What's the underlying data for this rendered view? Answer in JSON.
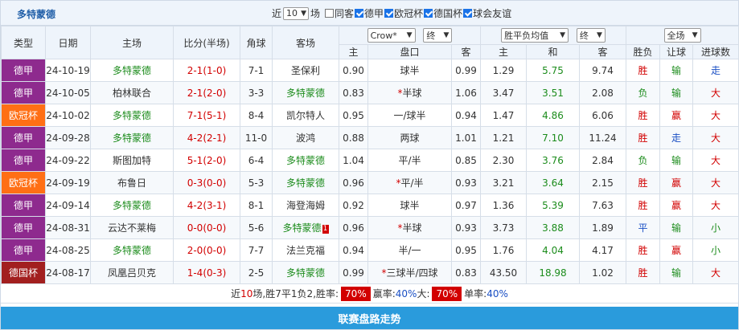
{
  "header": {
    "team_title": "多特蒙德",
    "near_label": "近",
    "near_count": "10",
    "games_label": "场",
    "filters": [
      {
        "label": "同客",
        "checked": false
      },
      {
        "label": "德甲",
        "checked": true
      },
      {
        "label": "欧冠杯",
        "checked": true
      },
      {
        "label": "德国杯",
        "checked": true
      },
      {
        "label": "球会友谊",
        "checked": true
      }
    ]
  },
  "columns": {
    "type": "类型",
    "date": "日期",
    "home": "主场",
    "score": "比分(半场)",
    "corner": "角球",
    "away": "客场",
    "bookmaker": "Crow*",
    "handicap_period": "终",
    "odds_type": "胜平负均值",
    "odds_period": "终",
    "scope": "全场",
    "sub_home": "主",
    "sub_line": "盘口",
    "sub_away": "客",
    "sub_odds_home": "主",
    "sub_odds_draw": "和",
    "sub_odds_away": "客",
    "result": "胜负",
    "handicap_result": "让球",
    "goals_result": "进球数"
  },
  "colors": {
    "league_bundesliga": "#8e2a8e",
    "league_ucl": "#ff6f15",
    "league_dfb": "#a21f1f",
    "win": "#d20000",
    "draw": "#1a4fc4",
    "loss": "#1c8c1c"
  },
  "matches": [
    {
      "league": "德甲",
      "league_color": "#8e2a8e",
      "date": "24-10-19",
      "home": "多特蒙德",
      "home_main": true,
      "score": "2-1",
      "half": "(1-0)",
      "corner": "7-1",
      "away": "圣保利",
      "away_main": false,
      "away_red": "",
      "h_home": "0.90",
      "h_star": "",
      "h_line": "球半",
      "h_away": "0.99",
      "o_home": "1.29",
      "o_draw": "5.75",
      "o_away": "9.74",
      "res": "胜",
      "res_c": "red",
      "hcp": "输",
      "hcp_c": "green",
      "goals": "走",
      "goals_c": "blue"
    },
    {
      "league": "德甲",
      "league_color": "#8e2a8e",
      "date": "24-10-05",
      "home": "柏林联合",
      "home_main": false,
      "score": "2-1",
      "half": "(2-0)",
      "corner": "3-3",
      "away": "多特蒙德",
      "away_main": true,
      "away_red": "",
      "h_home": "0.83",
      "h_star": "*",
      "h_line": "半球",
      "h_away": "1.06",
      "o_home": "3.47",
      "o_draw": "3.51",
      "o_away": "2.08",
      "res": "负",
      "res_c": "green",
      "hcp": "输",
      "hcp_c": "green",
      "goals": "大",
      "goals_c": "red"
    },
    {
      "league": "欧冠杯",
      "league_color": "#ff6f15",
      "date": "24-10-02",
      "home": "多特蒙德",
      "home_main": true,
      "score": "7-1",
      "half": "(5-1)",
      "corner": "8-4",
      "away": "凯尔特人",
      "away_main": false,
      "away_red": "",
      "h_home": "0.95",
      "h_star": "",
      "h_line": "一/球半",
      "h_away": "0.94",
      "o_home": "1.47",
      "o_draw": "4.86",
      "o_away": "6.06",
      "res": "胜",
      "res_c": "red",
      "hcp": "赢",
      "hcp_c": "red",
      "goals": "大",
      "goals_c": "red"
    },
    {
      "league": "德甲",
      "league_color": "#8e2a8e",
      "date": "24-09-28",
      "home": "多特蒙德",
      "home_main": true,
      "score": "4-2",
      "half": "(2-1)",
      "corner": "11-0",
      "away": "波鸿",
      "away_main": false,
      "away_red": "",
      "h_home": "0.88",
      "h_star": "",
      "h_line": "两球",
      "h_away": "1.01",
      "o_home": "1.21",
      "o_draw": "7.10",
      "o_away": "11.24",
      "res": "胜",
      "res_c": "red",
      "hcp": "走",
      "hcp_c": "blue",
      "goals": "大",
      "goals_c": "red"
    },
    {
      "league": "德甲",
      "league_color": "#8e2a8e",
      "date": "24-09-22",
      "home": "斯图加特",
      "home_main": false,
      "score": "5-1",
      "half": "(2-0)",
      "corner": "6-4",
      "away": "多特蒙德",
      "away_main": true,
      "away_red": "",
      "h_home": "1.04",
      "h_star": "",
      "h_line": "平/半",
      "h_away": "0.85",
      "o_home": "2.30",
      "o_draw": "3.76",
      "o_away": "2.84",
      "res": "负",
      "res_c": "green",
      "hcp": "输",
      "hcp_c": "green",
      "goals": "大",
      "goals_c": "red"
    },
    {
      "league": "欧冠杯",
      "league_color": "#ff6f15",
      "date": "24-09-19",
      "home": "布鲁日",
      "home_main": false,
      "score": "0-3",
      "half": "(0-0)",
      "corner": "5-3",
      "away": "多特蒙德",
      "away_main": true,
      "away_red": "",
      "h_home": "0.96",
      "h_star": "*",
      "h_line": "平/半",
      "h_away": "0.93",
      "o_home": "3.21",
      "o_draw": "3.64",
      "o_away": "2.15",
      "res": "胜",
      "res_c": "red",
      "hcp": "赢",
      "hcp_c": "red",
      "goals": "大",
      "goals_c": "red"
    },
    {
      "league": "德甲",
      "league_color": "#8e2a8e",
      "date": "24-09-14",
      "home": "多特蒙德",
      "home_main": true,
      "score": "4-2",
      "half": "(3-1)",
      "corner": "8-1",
      "away": "海登海姆",
      "away_main": false,
      "away_red": "",
      "h_home": "0.92",
      "h_star": "",
      "h_line": "球半",
      "h_away": "0.97",
      "o_home": "1.36",
      "o_draw": "5.39",
      "o_away": "7.63",
      "res": "胜",
      "res_c": "red",
      "hcp": "赢",
      "hcp_c": "red",
      "goals": "大",
      "goals_c": "red"
    },
    {
      "league": "德甲",
      "league_color": "#8e2a8e",
      "date": "24-08-31",
      "home": "云达不莱梅",
      "home_main": false,
      "score": "0-0",
      "half": "(0-0)",
      "corner": "5-6",
      "away": "多特蒙德",
      "away_main": true,
      "away_red": "1",
      "h_home": "0.96",
      "h_star": "*",
      "h_line": "半球",
      "h_away": "0.93",
      "o_home": "3.73",
      "o_draw": "3.88",
      "o_away": "1.89",
      "res": "平",
      "res_c": "blue",
      "hcp": "输",
      "hcp_c": "green",
      "goals": "小",
      "goals_c": "green"
    },
    {
      "league": "德甲",
      "league_color": "#8e2a8e",
      "date": "24-08-25",
      "home": "多特蒙德",
      "home_main": true,
      "score": "2-0",
      "half": "(0-0)",
      "corner": "7-7",
      "away": "法兰克福",
      "away_main": false,
      "away_red": "",
      "h_home": "0.94",
      "h_star": "",
      "h_line": "半/一",
      "h_away": "0.95",
      "o_home": "1.76",
      "o_draw": "4.04",
      "o_away": "4.17",
      "res": "胜",
      "res_c": "red",
      "hcp": "赢",
      "hcp_c": "red",
      "goals": "小",
      "goals_c": "green"
    },
    {
      "league": "德国杯",
      "league_color": "#a21f1f",
      "date": "24-08-17",
      "home": "凤凰吕贝克",
      "home_main": false,
      "score": "1-4",
      "half": "(0-3)",
      "corner": "2-5",
      "away": "多特蒙德",
      "away_main": true,
      "away_red": "",
      "h_home": "0.99",
      "h_star": "*",
      "h_line": "三球半/四球",
      "h_away": "0.83",
      "o_home": "43.50",
      "o_draw": "18.98",
      "o_away": "1.02",
      "res": "胜",
      "res_c": "red",
      "hcp": "输",
      "hcp_c": "green",
      "goals": "大",
      "goals_c": "red"
    }
  ],
  "summary": {
    "t1": "近",
    "n_games": "10",
    "t2": "场,胜",
    "wins": "7",
    "t3": "平",
    "draws": "1",
    "t4": "负",
    "losses": "2",
    "t5": ",胜率:",
    "win_rate": "70%",
    "t6": " 赢率:",
    "cover_rate": "40%",
    "t7": " 大:",
    "over_rate": "70%",
    "t8": " 单率:",
    "odd_rate": "40%"
  },
  "footer": {
    "button": "联赛盘路走势"
  }
}
